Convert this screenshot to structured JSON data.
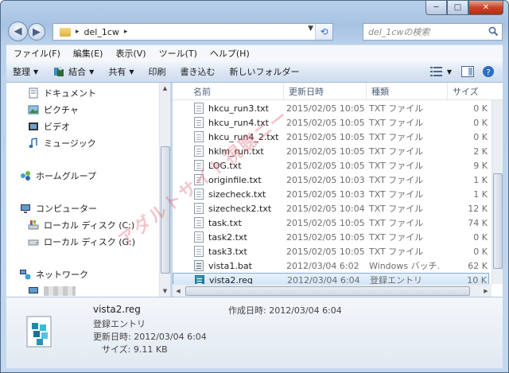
{
  "window": {
    "minimize": "─",
    "maximize": "□",
    "close": "✕"
  },
  "address": {
    "crumb": "del_1cw",
    "sep1": "▸",
    "sep2": "▸",
    "back_glyph": "◀",
    "forward_glyph": "▶",
    "dropdown": "▼",
    "refresh": "⟲"
  },
  "search": {
    "placeholder": "del_1cwの検索"
  },
  "menu": [
    "ファイル(F)",
    "編集(E)",
    "表示(V)",
    "ツール(T)",
    "ヘルプ(H)"
  ],
  "toolbar": {
    "organize": "整理",
    "combine": "結合",
    "share": "共有",
    "print": "印刷",
    "burn": "書き込む",
    "new_folder": "新しいフォルダー",
    "dropdown_arrow": "▼"
  },
  "nav": {
    "documents": "ドキュメント",
    "pictures": "ピクチャ",
    "videos": "ビデオ",
    "music": "ミュージック",
    "homegroup": "ホームグループ",
    "computer": "コンピューター",
    "drive_c": "ローカル ディスク (C:)",
    "drive_g": "ローカル ディスク (G:)",
    "network": "ネットワーク"
  },
  "columns": {
    "name": "名前",
    "date": "更新日時",
    "type": "種類",
    "size": "サイズ"
  },
  "files": [
    {
      "name": "hkcu_run3.txt",
      "date": "2015/02/05 10:05",
      "type": "TXT ファイル",
      "size": "0 K",
      "icon": "txt"
    },
    {
      "name": "hkcu_run4.txt",
      "date": "2015/02/05 10:05",
      "type": "TXT ファイル",
      "size": "0 K",
      "icon": "txt"
    },
    {
      "name": "hkcu_run4_2.txt",
      "date": "2015/02/05 10:05",
      "type": "TXT ファイル",
      "size": "0 K",
      "icon": "txt"
    },
    {
      "name": "hklm_run.txt",
      "date": "2015/02/05 10:05",
      "type": "TXT ファイル",
      "size": "2 K",
      "icon": "txt"
    },
    {
      "name": "LOG.txt",
      "date": "2015/02/05 10:05",
      "type": "TXT ファイル",
      "size": "9 K",
      "icon": "txt"
    },
    {
      "name": "originfile.txt",
      "date": "2015/02/05 10:03",
      "type": "TXT ファイル",
      "size": "1 K",
      "icon": "txt"
    },
    {
      "name": "sizecheck.txt",
      "date": "2015/02/05 10:03",
      "type": "TXT ファイル",
      "size": "1 K",
      "icon": "txt"
    },
    {
      "name": "sizecheck2.txt",
      "date": "2015/02/05 10:04",
      "type": "TXT ファイル",
      "size": "12 K",
      "icon": "txt"
    },
    {
      "name": "task.txt",
      "date": "2015/02/05 10:05",
      "type": "TXT ファイル",
      "size": "74 K",
      "icon": "txt"
    },
    {
      "name": "task2.txt",
      "date": "2015/02/05 10:05",
      "type": "TXT ファイル",
      "size": "0 K",
      "icon": "txt"
    },
    {
      "name": "task3.txt",
      "date": "2015/02/05 10:05",
      "type": "TXT ファイル",
      "size": "0 K",
      "icon": "txt"
    },
    {
      "name": "vista1.bat",
      "date": "2012/03/04 6:02",
      "type": "Windows バッチ...",
      "size": "62 K",
      "icon": "bat"
    },
    {
      "name": "vista2.reg",
      "date": "2012/03/04 6:04",
      "type": "登録エントリ",
      "size": "10 K",
      "icon": "reg",
      "selected": true
    }
  ],
  "details": {
    "filename": "vista2.reg",
    "filetype": "登録エントリ",
    "created": "作成日時: 2012/03/04 6:04",
    "modified": "更新日時: 2012/03/04 6:04",
    "size": "サイズ: 9.11 KB"
  },
  "watermark": "アダルトサイト視聴ニー"
}
